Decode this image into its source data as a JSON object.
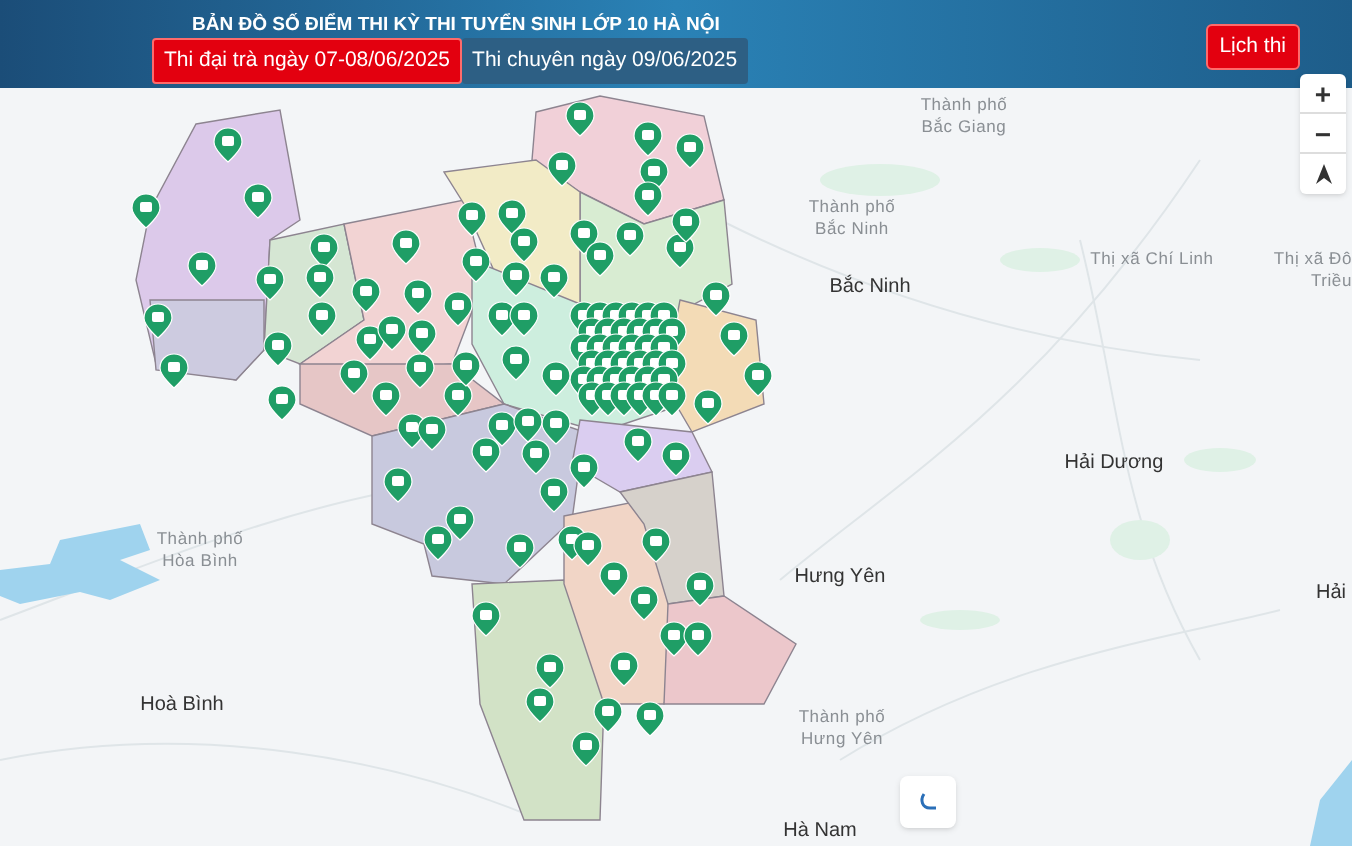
{
  "header": {
    "title": "BẢN ĐỒ SỐ ĐIỂM THI KỲ THI TUYỂN SINH LỚP 10 HÀ NỘI",
    "tabs": [
      {
        "label": "Thi đại trà ngày 07-08/06/2025",
        "selected": true
      },
      {
        "label": "Thi chuyên ngày 09/06/2025",
        "selected": false
      }
    ],
    "schedule_button": "Lịch thi"
  },
  "map": {
    "zoom_controls": [
      "+",
      "−"
    ],
    "labels": [
      {
        "kind": "minor",
        "lines": [
          "Thành phố",
          "Bắc Giang"
        ]
      },
      {
        "kind": "minor",
        "lines": [
          "Thành phố",
          "Bắc Ninh"
        ]
      },
      {
        "kind": "major",
        "lines": [
          "Bắc Ninh"
        ]
      },
      {
        "kind": "minor",
        "lines": [
          "Thị xã Chí Linh"
        ]
      },
      {
        "kind": "minor",
        "lines": [
          "Thị xã Đô",
          "Triều"
        ]
      },
      {
        "kind": "major",
        "lines": [
          "Hải Dương"
        ]
      },
      {
        "kind": "major",
        "lines": [
          "Hưng Yên"
        ]
      },
      {
        "kind": "minor",
        "lines": [
          "Thành phố",
          "Hưng Yên"
        ]
      },
      {
        "kind": "minor",
        "lines": [
          "Thành phố",
          "Hòa Bình"
        ]
      },
      {
        "kind": "major",
        "lines": [
          "Hoà Bình"
        ]
      },
      {
        "kind": "major",
        "lines": [
          "Hải"
        ]
      },
      {
        "kind": "major",
        "lines": [
          "Hà Nam"
        ]
      }
    ]
  }
}
